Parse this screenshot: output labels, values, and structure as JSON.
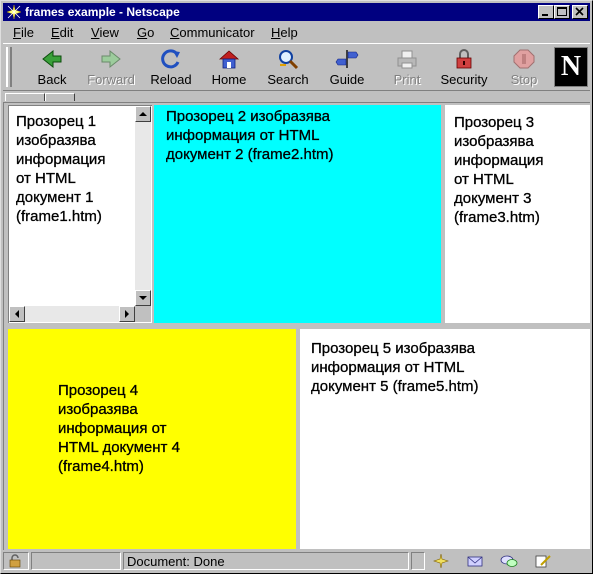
{
  "window": {
    "title": "frames example - Netscape"
  },
  "menu": [
    "File",
    "Edit",
    "View",
    "Go",
    "Communicator",
    "Help"
  ],
  "menu_mnemonics": [
    "F",
    "E",
    "V",
    "G",
    "C",
    "H"
  ],
  "toolbar": {
    "back": "Back",
    "forward": "Forward",
    "reload": "Reload",
    "home": "Home",
    "search": "Search",
    "guide": "Guide",
    "print": "Print",
    "security": "Security",
    "stop": "Stop",
    "logo": "N"
  },
  "frames": {
    "frame1": "Прозорец 1 изобразява информация от HTML документ 1 (frame1.htm)",
    "frame2": "Прозорец 2 изобразява информация от HTML документ 2 (frame2.htm)",
    "frame3": "Прозорец 3 изобразява информация от HTML документ 3 (frame3.htm)",
    "frame4": "Прозорец 4 изобразява информация от HTML документ 4 (frame4.htm)",
    "frame5": "Прозорец 5 изобразява информация от HTML документ 5 (frame5.htm)"
  },
  "frame_lines": {
    "frame1": [
      "Прозорец 1",
      "изобразява",
      "информация",
      "от HTML",
      "документ 1",
      "(frame1.htm)"
    ],
    "frame2": [
      "Прозорец 2 изобразява",
      "информация от HTML",
      "документ 2 (frame2.htm)"
    ],
    "frame3": [
      "Прозорец 3",
      "изобразява",
      "информация",
      "от HTML",
      "документ 3",
      "(frame3.htm)"
    ],
    "frame4": [
      "Прозорец 4",
      "изобразява",
      "информация от",
      "HTML документ 4",
      "(frame4.htm)"
    ],
    "frame5": [
      "Прозорец 5 изобразява",
      "информация от HTML",
      "документ 5 (frame5.htm)"
    ]
  },
  "status": {
    "text": "Document: Done"
  },
  "colors": {
    "titlebar": "#000080",
    "frame2_bg": "#00ffff",
    "frame4_bg": "#ffff00",
    "chrome": "#c0c0c0"
  }
}
